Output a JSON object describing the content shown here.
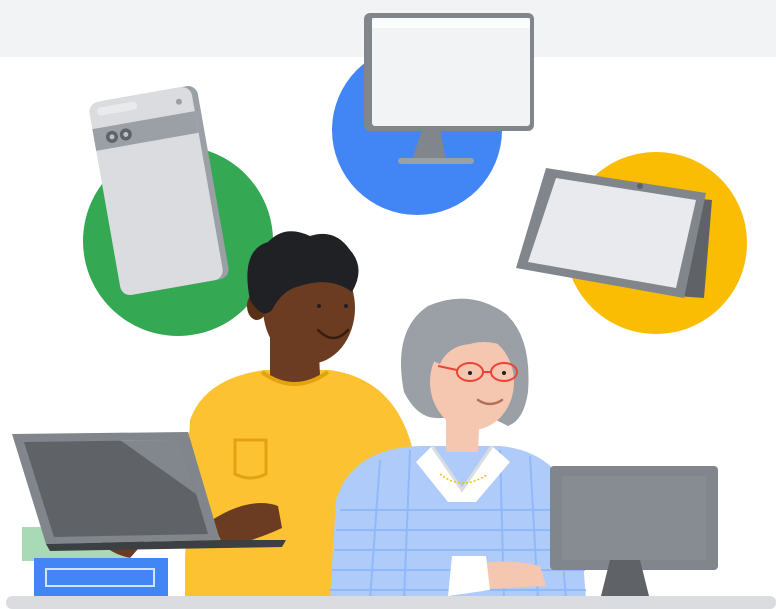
{
  "illustration": {
    "devices": [
      "phone-icon",
      "monitor-icon",
      "tablet-icon",
      "laptop-icon",
      "desktop-monitor-icon"
    ],
    "people": [
      "young-man-in-yellow-sweater",
      "older-woman-in-blue-plaid-sweater"
    ],
    "colors": {
      "top_band": "#F1F3F4",
      "green_circle": "#34A853",
      "blue_circle": "#4285F4",
      "yellow_circle": "#FBBC04",
      "yellow_sweater": "#FDC232",
      "blue_sweater": "#AECBFA",
      "plaid_lines": "#8AB4F8",
      "device_gray": "#80868B",
      "screen_light": "#E8EAED",
      "dark_skin": "#6B3B22",
      "hair_dark": "#202124",
      "hair_gray": "#9AA0A6",
      "light_skin": "#F6C7B0",
      "books_green": "#A8DAB5",
      "books_blue": "#4285F4",
      "desk": "#DADCE0"
    }
  }
}
